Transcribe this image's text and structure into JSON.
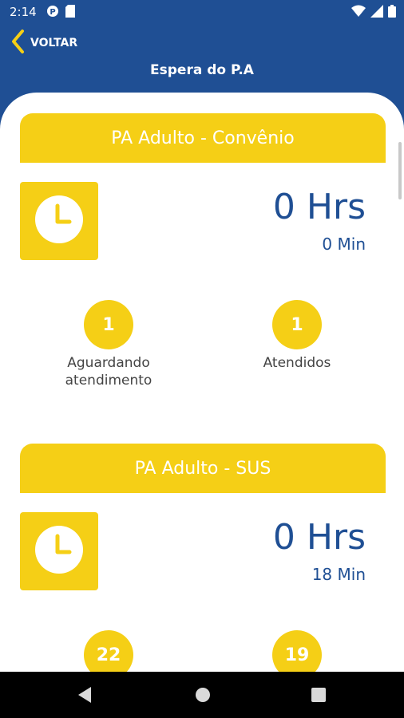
{
  "status_bar": {
    "time": "2:14"
  },
  "header": {
    "back_label": "VOLTAR",
    "title": "Espera do P.A"
  },
  "cards": [
    {
      "title": "PA Adulto - Convênio",
      "hours": "0 Hrs",
      "minutes": "0 Min",
      "waiting_count": "1",
      "waiting_label": "Aguardando\natendimento",
      "served_count": "1",
      "served_label": "Atendidos"
    },
    {
      "title": "PA Adulto - SUS",
      "hours": "0 Hrs",
      "minutes": "18 Min",
      "waiting_count": "22",
      "served_count": "19"
    }
  ],
  "colors": {
    "primary_blue": "#1f4f94",
    "accent_yellow": "#f5cf16"
  },
  "icons": {
    "back": "chevron-left-icon",
    "clock": "clock-icon",
    "nav_back": "triangle-back-icon",
    "nav_home": "circle-home-icon",
    "nav_recents": "square-recents-icon"
  }
}
